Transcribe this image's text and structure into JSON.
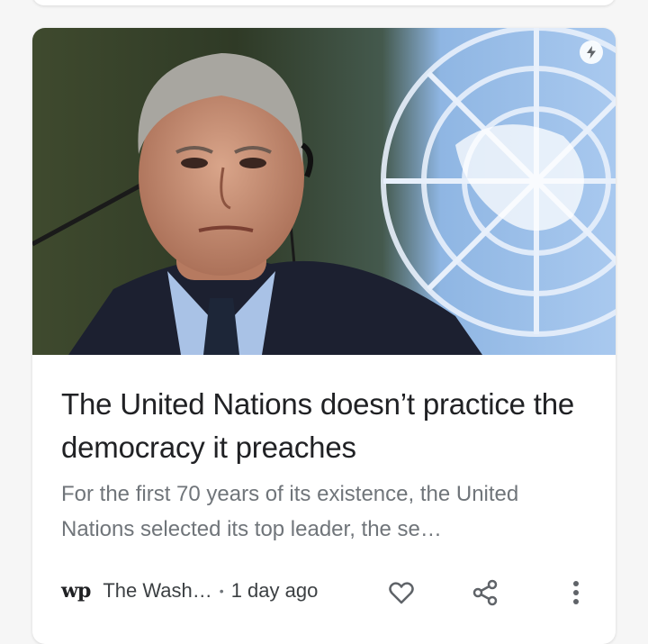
{
  "article": {
    "title": "The United Nations doesn’t practice the democracy it preaches",
    "snippet": "For the first 70 years of its existence, the United Nations selected its top leader, the se…",
    "source": "The Wash…",
    "source_logo": "wp",
    "separator": "•",
    "time": "1 day ago"
  },
  "icons": {
    "amp": "lightning-bolt-icon",
    "like": "heart-icon",
    "share": "share-icon",
    "more": "more-vert-icon"
  },
  "colors": {
    "title": "#202124",
    "snippet": "#70757a",
    "icon": "#5f6368",
    "un_blue": "#5b92e5"
  }
}
